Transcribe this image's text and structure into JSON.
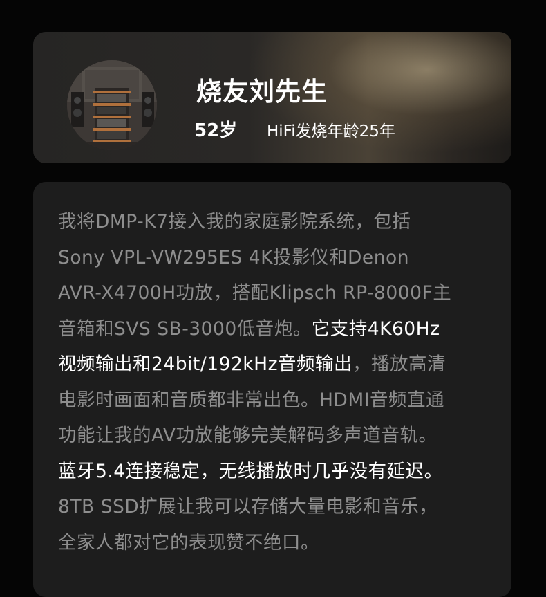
{
  "profile": {
    "name": "烧友刘先生",
    "age": "52岁",
    "hifi_years": "HiFi发烧年龄25年"
  },
  "review": {
    "lines": [
      [
        {
          "text": "我将DMP-K7接入我的家庭影院系统，包括",
          "highlight": false
        }
      ],
      [
        {
          "text": "Sony VPL-VW295ES 4K投影仪和Denon",
          "highlight": false
        }
      ],
      [
        {
          "text": "AVR-X4700H功放，搭配Klipsch RP-8000F主",
          "highlight": false
        }
      ],
      [
        {
          "text": "音箱和SVS SB-3000低音炮。",
          "highlight": false
        },
        {
          "text": "它支持4K60Hz",
          "highlight": true
        }
      ],
      [
        {
          "text": "视频输出和24bit/192kHz音频输出",
          "highlight": true
        },
        {
          "text": "，播放高清",
          "highlight": false
        }
      ],
      [
        {
          "text": "电影时画面和音质都非常出色。HDMI音频直通",
          "highlight": false
        }
      ],
      [
        {
          "text": "功能让我的AV功放能够完美解码多声道音轨。",
          "highlight": false
        }
      ],
      [
        {
          "text": "蓝牙5.4连接稳定，无线播放时几乎没有延迟。",
          "highlight": true
        }
      ],
      [
        {
          "text": "8TB SSD扩展让我可以存储大量电影和音乐，",
          "highlight": false
        }
      ],
      [
        {
          "text": "全家人都对它的表现赞不绝口。",
          "highlight": false
        }
      ]
    ]
  }
}
